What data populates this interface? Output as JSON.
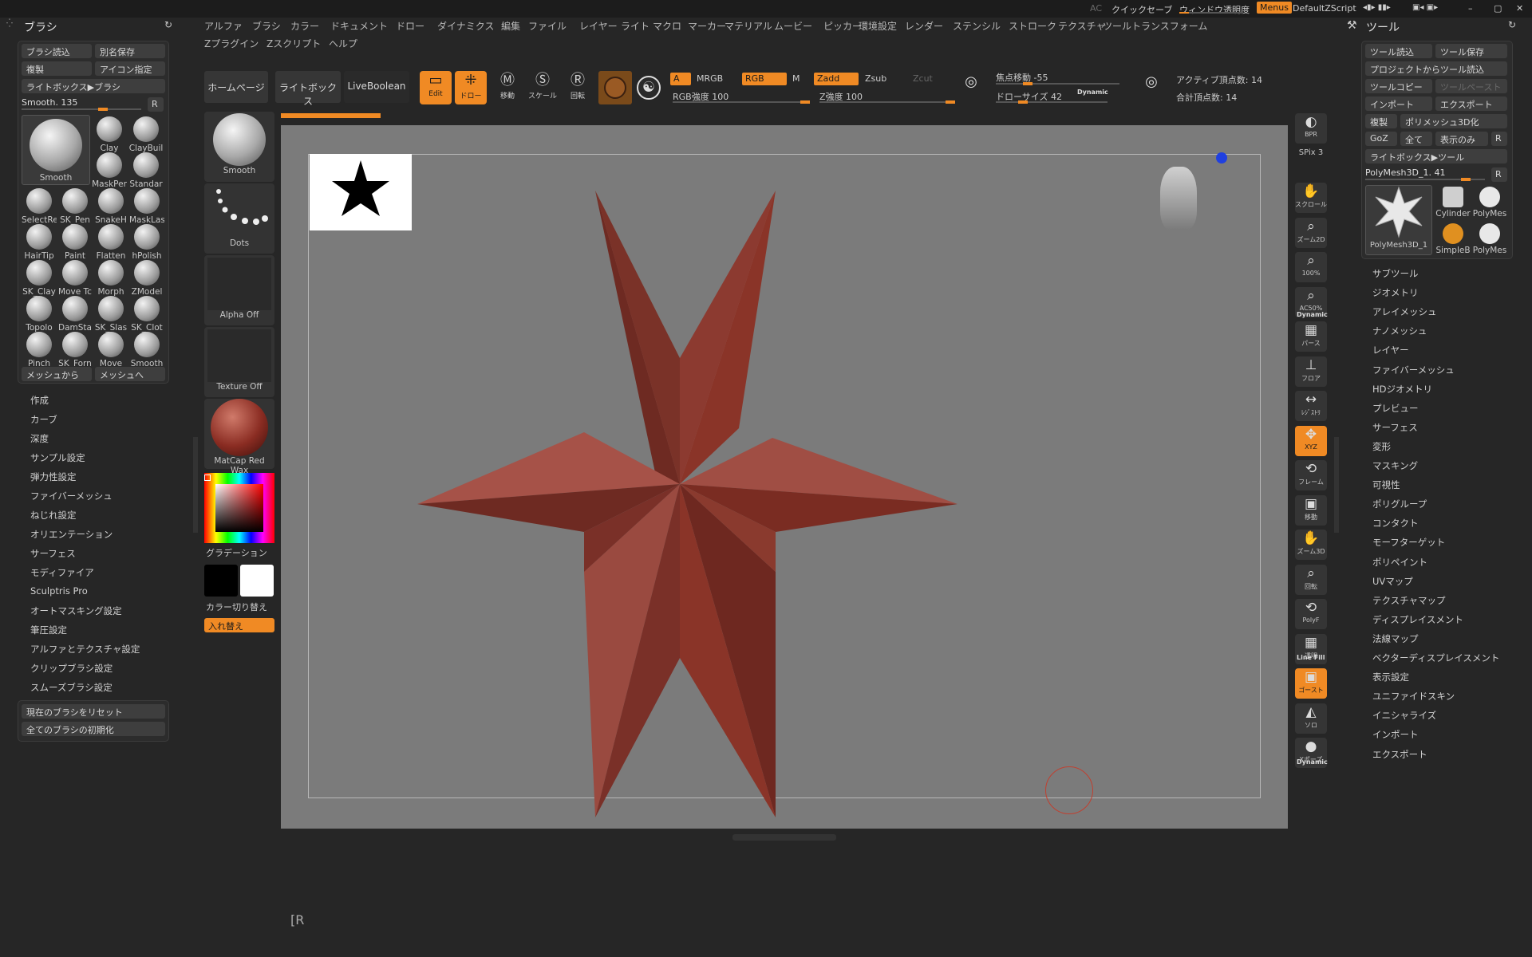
{
  "topbar": {
    "ac": "AC",
    "quicksave": "クイックセーブ",
    "transparency": "ウィンドウ透明度",
    "menus": "Menus",
    "script": "DefaultZScript"
  },
  "menubar": {
    "row1": [
      "アルファ",
      "ブラシ",
      "カラー",
      "ドキュメント",
      "ドロー",
      "ダイナミクス",
      "編集",
      "ファイル",
      "レイヤー",
      "ライト",
      "マクロ",
      "マーカー",
      "マテリアル",
      "ムービー",
      "ピッカー",
      "環境設定",
      "レンダー",
      "ステンシル",
      "ストローク",
      "テクスチャ",
      "ツール",
      "トランスフォーム"
    ],
    "row2": [
      "Zプラグイン",
      "Zスクリプト",
      "ヘルプ"
    ]
  },
  "brush_panel": {
    "title": "ブラシ",
    "load": "ブラシ読込",
    "save_as": "別名保存",
    "clone": "複製",
    "icon": "アイコン指定",
    "lightbox": "ライトボックス▶ブラシ",
    "smooth_label": "Smooth. 135",
    "smooth_value": 135,
    "r": "R",
    "current": "Smooth",
    "thumbs": [
      "Clay",
      "ClayBuil",
      "MaskPer",
      "Standar",
      "SelectRe",
      "SK_Pen",
      "SnakeH",
      "MaskLas",
      "HairTip",
      "Paint",
      "Flatten",
      "hPolish",
      "SK_Clay",
      "Move Tc",
      "Morph",
      "ZModel",
      "Topolo",
      "DamSta",
      "SK_Slas",
      "SK_Clot",
      "Pinch",
      "SK_Forn",
      "Move",
      "Smooth"
    ],
    "from_mesh": "メッシュから",
    "to_mesh": "メッシュへ",
    "sections": [
      "作成",
      "カーブ",
      "深度",
      "サンプル設定",
      "弾力性設定",
      "ファイバーメッシュ",
      "ねじれ設定",
      "オリエンテーション",
      "サーフェス",
      "モディファイア",
      "Sculptris Pro",
      "オートマスキング設定",
      "筆圧設定",
      "アルファとテクスチャ設定",
      "クリップブラシ設定",
      "スムーズブラシ設定"
    ],
    "reset": "現在のブラシをリセット",
    "init_all": "全てのブラシの初期化"
  },
  "left_shelf": {
    "brush": "Smooth",
    "stroke": "Dots",
    "alpha": "Alpha Off",
    "texture": "Texture Off",
    "material": "MatCap Red Wax",
    "gradient": "グラデーション",
    "switch_color": "カラー切り替え",
    "swap": "入れ替え"
  },
  "toolbar": {
    "homepage": "ホームページ",
    "lightbox": "ライトボックス",
    "liveboolean": "LiveBoolean",
    "edit": "Edit",
    "draw": "ドロー",
    "move": "移動",
    "scale": "スケール",
    "rotate": "回転",
    "a": "A",
    "mrgb": "MRGB",
    "rgb": "RGB",
    "m": "M",
    "rgb_intensity": "RGB強度 100",
    "zadd": "Zadd",
    "zsub": "Zsub",
    "zcut": "Zcut",
    "z_intensity": "Z強度 100",
    "focal_shift": "焦点移動 -55",
    "draw_size": "ドローサイズ 42",
    "dynamic": "Dynamic",
    "active_points": "アクティブ頂点数: 14",
    "total_points": "合計頂点数: 14"
  },
  "right_shelf": [
    "BPR",
    "SPix 3",
    "スクロール",
    "ズーム2D",
    "100%",
    "AC50%",
    "パース",
    "フロア",
    "ﾚｼﾞｽﾄﾘ",
    "XYZ",
    "フレーム",
    "移動",
    "ズーム3D",
    "回転",
    "PolyF",
    "透明",
    "ゴースト",
    "ソロ",
    "Xポーズ"
  ],
  "right_shelf_extra": {
    "dynamic": "Dynamic",
    "linefill": "Line Fill",
    "dynamic2": "Dynamic"
  },
  "tool_panel": {
    "title": "ツール",
    "load": "ツール読込",
    "save": "ツール保存",
    "load_project": "プロジェクトからツール読込",
    "copy": "ツールコピー",
    "paste": "ツールペースト",
    "import": "インポート",
    "export": "エクスポート",
    "clone": "複製",
    "polymesh": "ポリメッシュ3D化",
    "goz": "GoZ",
    "all": "全て",
    "visible": "表示のみ",
    "r": "R",
    "lightbox": "ライトボックス▶ツール",
    "current_label": "PolyMesh3D_1. 41",
    "current_value": 41,
    "current": "PolyMesh3D_1",
    "thumbs": [
      "Cylinder",
      "PolyMes",
      "SimpleB",
      "PolyMes"
    ],
    "sections": [
      "サブツール",
      "ジオメトリ",
      "アレイメッシュ",
      "ナノメッシュ",
      "レイヤー",
      "ファイバーメッシュ",
      "HDジオメトリ",
      "プレビュー",
      "サーフェス",
      "変形",
      "マスキング",
      "可視性",
      "ポリグループ",
      "コンタクト",
      "モーフターゲット",
      "ポリペイント",
      "UVマップ",
      "テクスチャマップ",
      "ディスプレイスメント",
      "法線マップ",
      "ベクターディスプレイスメント",
      "表示設定",
      "ユニファイドスキン",
      "イニシャライズ",
      "インポート",
      "エクスポート"
    ]
  },
  "footer": {
    "text": "[R"
  }
}
